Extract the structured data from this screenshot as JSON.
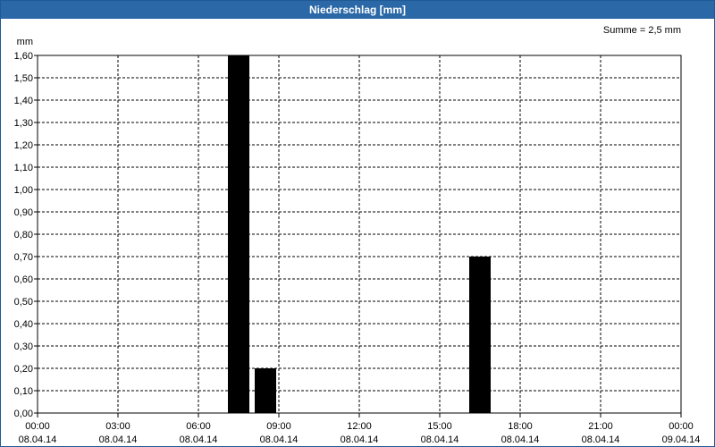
{
  "window": {
    "title": "Niederschlag [mm]"
  },
  "chart_data": {
    "type": "bar",
    "title": "Niederschlag [mm]",
    "ylabel": "mm",
    "sum_label": "Summe = 2,5 mm",
    "ylim": [
      0,
      1.6
    ],
    "y_ticks": [
      "0,00",
      "0,10",
      "0,20",
      "0,30",
      "0,40",
      "0,50",
      "0,60",
      "0,70",
      "0,80",
      "0,90",
      "1,00",
      "1,10",
      "1,20",
      "1,30",
      "1,40",
      "1,50",
      "1,60"
    ],
    "x_range_hours": [
      0,
      24
    ],
    "x_ticks": [
      {
        "time": "00:00",
        "date": "08.04.14"
      },
      {
        "time": "03:00",
        "date": "08.04.14"
      },
      {
        "time": "06:00",
        "date": "08.04.14"
      },
      {
        "time": "09:00",
        "date": "08.04.14"
      },
      {
        "time": "12:00",
        "date": "08.04.14"
      },
      {
        "time": "15:00",
        "date": "08.04.14"
      },
      {
        "time": "18:00",
        "date": "08.04.14"
      },
      {
        "time": "21:00",
        "date": "08.04.14"
      },
      {
        "time": "00:00",
        "date": "09.04.14"
      }
    ],
    "bars": [
      {
        "start": "07:00",
        "end": "08:00",
        "value": 1.6
      },
      {
        "start": "08:00",
        "end": "09:00",
        "value": 0.2
      },
      {
        "start": "16:00",
        "end": "17:00",
        "value": 0.7
      }
    ],
    "bar_color": "#000000",
    "grid": true,
    "grid_style": "dashed"
  }
}
